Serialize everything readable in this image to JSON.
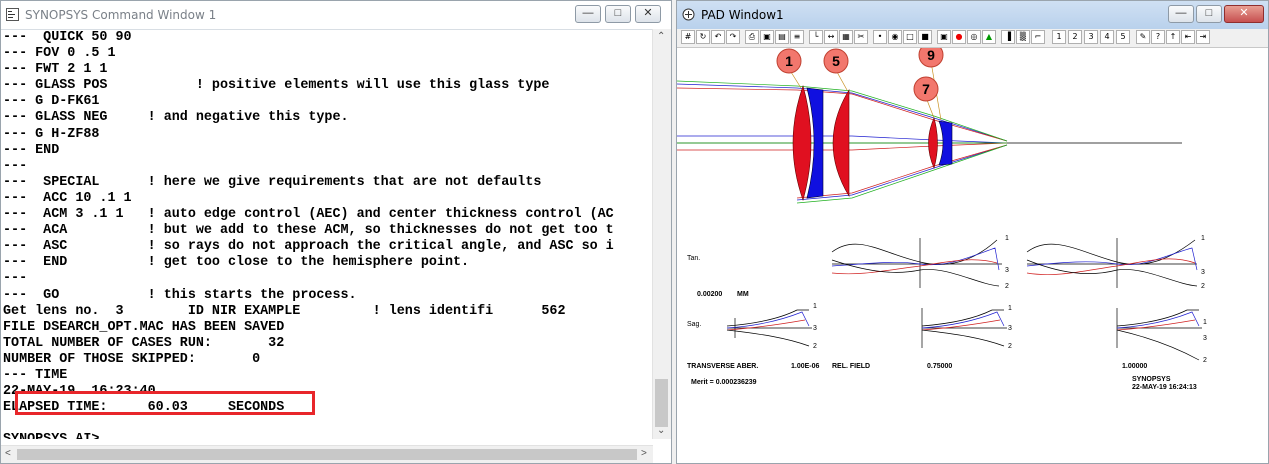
{
  "cmd_window": {
    "title": "SYNOPSYS Command Window 1",
    "lines": [
      "---  QUICK 50 90",
      "--- FOV 0 .5 1",
      "--- FWT 2 1 1",
      "--- GLASS POS           ! positive elements will use this glass type",
      "--- G D-FK61",
      "--- GLASS NEG     ! and negative this type.",
      "--- G H-ZF88",
      "--- END",
      "---",
      "---  SPECIAL      ! here we give requirements that are not defaults",
      "---  ACC 10 .1 1",
      "---  ACM 3 .1 1   ! auto edge control (AEC) and center thickness control (AC",
      "---  ACA          ! but we add to these ACM, so thicknesses do not get too t",
      "---  ASC          ! so rays do not approach the critical angle, and ASC so i",
      "---  END          ! get too close to the hemisphere point.",
      "---",
      "---  GO           ! this starts the process.",
      "Get lens no.  3        ID NIR EXAMPLE         ! lens identifi      562",
      "FILE DSEARCH_OPT.MAC HAS BEEN SAVED",
      "TOTAL NUMBER OF CASES RUN:       32",
      "NUMBER OF THOSE SKIPPED:       0",
      "--- TIME",
      "22-MAY-19  16:23:40",
      "ELAPSED TIME:     60.03     SECONDS",
      "",
      "SYNOPSYS AI>"
    ],
    "highlight_color": "#e8262a"
  },
  "pad_window": {
    "title": "PAD Window1",
    "toolbar_icons": [
      "grid-icon",
      "rotate-icon",
      "undo-icon",
      "redo-icon",
      "print-icon",
      "preview-icon",
      "save-icon",
      "list-icon",
      "axes-icon",
      "scale-icon",
      "table-icon",
      "tools-icon",
      "points-icon",
      "spot-icon",
      "square-icon",
      "fill-icon",
      "marker-icon",
      "red-dot-icon",
      "circle-icon",
      "color-icon",
      "bars-icon",
      "pattern-icon",
      "ruler-icon"
    ],
    "toolbar_numbers": [
      "1",
      "2",
      "3",
      "4",
      "5"
    ],
    "toolbar_end_icons": [
      "pen-icon",
      "help-icon",
      "up-icon",
      "first-icon",
      "last-icon"
    ],
    "element_labels": [
      "1",
      "5",
      "9",
      "7"
    ],
    "label_color": "#f2776d",
    "aberration": {
      "tan_label": "Tan.",
      "sag_label": "Sag.",
      "scale_value": "0.00200",
      "scale_unit": "MM",
      "curve_labels": [
        "1",
        "3",
        "2"
      ],
      "footer_type": "TRANSVERSE ABER.",
      "footer_wavelength": "1.00E-06",
      "footer_field": "REL. FIELD",
      "field_1": "0.75000",
      "field_2": "1.00000",
      "merit": "Merit = 0.000236239",
      "brand": "SYNOPSYS",
      "timestamp": "22-MAY-19  16:24:13"
    }
  }
}
